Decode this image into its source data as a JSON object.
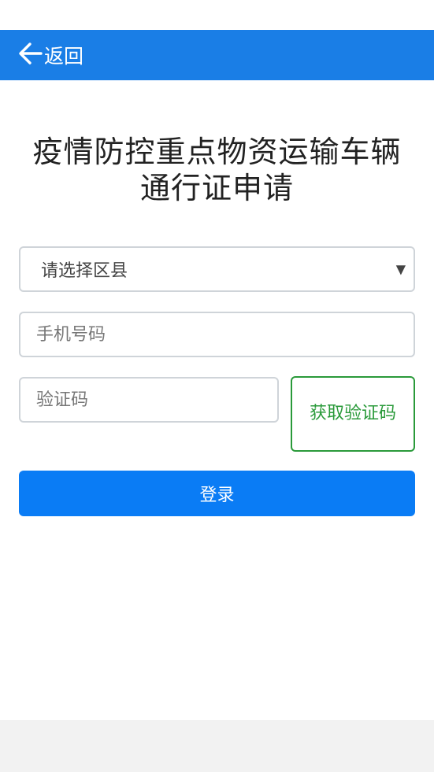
{
  "header": {
    "back_label": "返回",
    "background_color": "#1a7ee6"
  },
  "main": {
    "title_line1": "疫情防控重点物资运输车辆",
    "title_line2": "通行证申请"
  },
  "form": {
    "district_select": {
      "selected": "请选择区县"
    },
    "phone_input": {
      "value": "",
      "placeholder": "手机号码"
    },
    "code_input": {
      "value": "",
      "placeholder": "验证码"
    },
    "get_code_button_label": "获取验证码",
    "get_code_button_color": "#2a9a3a",
    "login_button_label": "登录",
    "login_button_color": "#0a7cf5"
  },
  "icons": {
    "back": "arrow-left-icon",
    "select_arrow": "triangle-down-icon"
  }
}
